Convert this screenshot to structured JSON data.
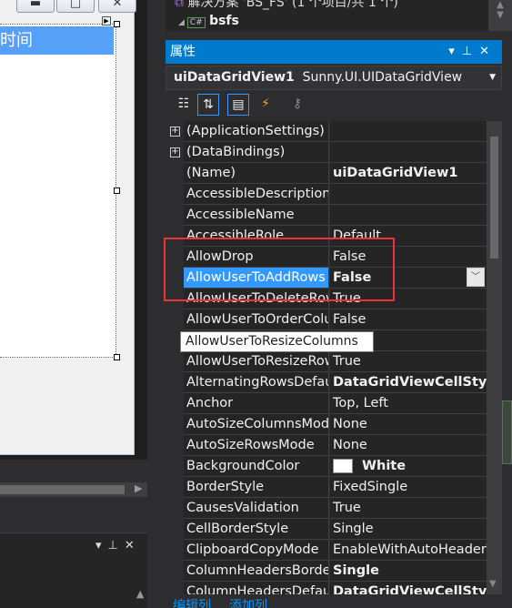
{
  "designer": {
    "column_header": "限时间",
    "window_buttons": [
      "minimize",
      "maximize",
      "close"
    ]
  },
  "solution": {
    "solution_label": "解决方案 'BS_FS' (1 个项目/共 1 个)",
    "project": "bsfs",
    "project_badge": "C#"
  },
  "properties": {
    "title": "属性",
    "object_name": "uiDataGridView1",
    "object_type": "Sunny.UI.UIDataGridView",
    "selected_row": "AllowUserToAddRows",
    "tooltip": "AllowUserToResizeColumns",
    "rows": [
      {
        "name": "(ApplicationSettings)",
        "value": "",
        "expandable": true
      },
      {
        "name": "(DataBindings)",
        "value": "",
        "expandable": true
      },
      {
        "name": "(Name)",
        "value": "uiDataGridView1",
        "bold": true
      },
      {
        "name": "AccessibleDescription",
        "value": ""
      },
      {
        "name": "AccessibleName",
        "value": ""
      },
      {
        "name": "AccessibleRole",
        "value": "Default"
      },
      {
        "name": "AllowDrop",
        "value": "False"
      },
      {
        "name": "AllowUserToAddRows",
        "value": "False",
        "bold": true,
        "selected": true
      },
      {
        "name": "AllowUserToDeleteRows",
        "value": "True"
      },
      {
        "name": "AllowUserToOrderColumns",
        "value": "False"
      },
      {
        "name": "AllowUserToResizeColumns",
        "value": "True"
      },
      {
        "name": "AllowUserToResizeRows",
        "value": "True"
      },
      {
        "name": "AlternatingRowsDefaultCellStyle",
        "value": "DataGridViewCellStyle",
        "bold": true
      },
      {
        "name": "Anchor",
        "value": "Top, Left"
      },
      {
        "name": "AutoSizeColumnsMode",
        "value": "None"
      },
      {
        "name": "AutoSizeRowsMode",
        "value": "None"
      },
      {
        "name": "BackgroundColor",
        "value": "White",
        "bold": true,
        "swatch": "#ffffff"
      },
      {
        "name": "BorderStyle",
        "value": "FixedSingle"
      },
      {
        "name": "CausesValidation",
        "value": "True"
      },
      {
        "name": "CellBorderStyle",
        "value": "Single"
      },
      {
        "name": "ClipboardCopyMode",
        "value": "EnableWithAutoHeaderText"
      },
      {
        "name": "ColumnHeadersBorderStyle",
        "value": "Single",
        "bold": true
      },
      {
        "name": "ColumnHeadersDefaultCellStyle",
        "value": "DataGridViewCellStyle",
        "bold": true
      }
    ],
    "links": [
      "编辑列",
      "添加列"
    ]
  },
  "colors": {
    "accent": "#007acc",
    "selection": "#3399ff",
    "highlight_box": "#e8343a"
  }
}
